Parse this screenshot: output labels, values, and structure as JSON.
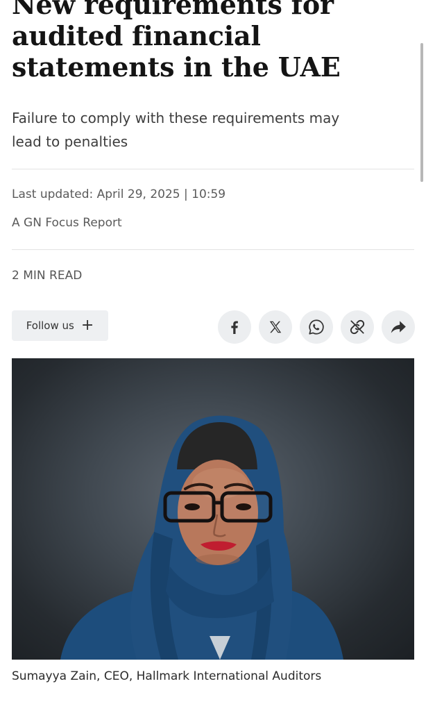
{
  "article": {
    "headline_lines": [
      "New requirements for",
      "audited financial",
      "statements in the UAE"
    ],
    "subheadline_lines": [
      "Failure to comply with these requirements may",
      "lead to penalties"
    ],
    "last_updated": "Last updated: April 29, 2025 | 10:59",
    "byline": "A GN Focus Report",
    "read_time": "2 MIN READ"
  },
  "actions": {
    "follow_label": "Follow us",
    "follow_icon": "plus-icon",
    "share_icons": [
      "facebook-icon",
      "x-icon",
      "whatsapp-icon",
      "link-icon",
      "share-arrow-icon"
    ]
  },
  "image": {
    "caption": "Sumayya Zain, CEO, Hallmark International Auditors"
  },
  "colors": {
    "background": "#ffffff",
    "headline": "#141414",
    "body_text": "#3d3d3d",
    "meta_text": "#5a5a5a",
    "button_bg": "#eef0f2",
    "hijab_blue": "#1f4f7c",
    "photo_bg": "#3b434b"
  }
}
